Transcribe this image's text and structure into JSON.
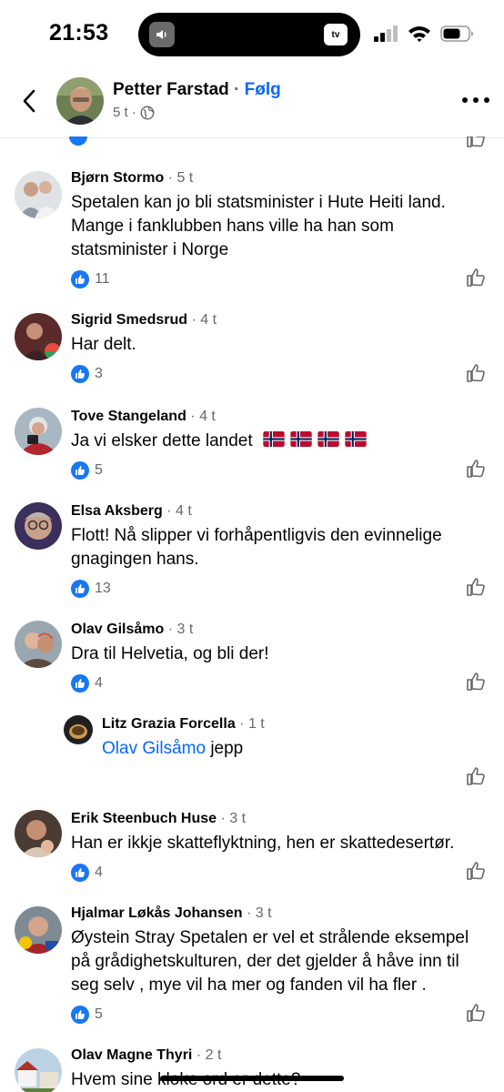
{
  "status_bar": {
    "time": "21:53",
    "island_left_icon": "speaker-icon",
    "island_right_label": "tv"
  },
  "header": {
    "author": "Petter Farstad",
    "separator": "·",
    "follow": "Følg",
    "time": "5 t",
    "privacy_icon": "globe-icon"
  },
  "comments": [
    {
      "name": "Bjørn Stormo",
      "time": "5 t",
      "text": "Spetalen kan jo bli statsminister i Hute Heiti land. Mange i fanklubben hans ville ha han som statsminister i Norge",
      "likes": "11"
    },
    {
      "name": "Sigrid Smedsrud",
      "time": "4 t",
      "text": "Har delt.",
      "likes": "3"
    },
    {
      "name": "Tove Stangeland",
      "time": "4 t",
      "text": "Ja vi elsker dette landet",
      "likes": "5",
      "flags": 4
    },
    {
      "name": "Elsa Aksberg",
      "time": "4 t",
      "text": "Flott! Nå slipper vi forhåpentligvis den evinnelige gnagingen hans.",
      "likes": "13"
    },
    {
      "name": "Olav Gilsåmo",
      "time": "3 t",
      "text": "Dra til Helvetia, og bli der!",
      "likes": "4"
    },
    {
      "name": "Litz Grazia Forcella",
      "time": "1 t",
      "mention": "Olav Gilsåmo",
      "text": "jepp",
      "reply": true
    },
    {
      "name": "Erik Steenbuch Huse",
      "time": "3 t",
      "text": "Han er ikkje skatteflyktning, hen er skattedesertør.",
      "likes": "4"
    },
    {
      "name": "Hjalmar Løkås Johansen",
      "time": "3 t",
      "text": "Øystein Stray Spetalen er vel et strålende eksempel på grådighetskulturen, der det gjelder å håve inn til seg selv , mye vil ha mer og fanden vil ha fler .",
      "likes": "5"
    },
    {
      "name": "Olav Magne Thyri",
      "time": "2 t",
      "text": "Hvem sine kloke ord er dette?"
    }
  ],
  "colors": {
    "link": "#0866ff",
    "meta": "#65676b",
    "like_badge": "#1877f2",
    "norway_red": "#ba0c2f",
    "norway_blue": "#00205b"
  }
}
